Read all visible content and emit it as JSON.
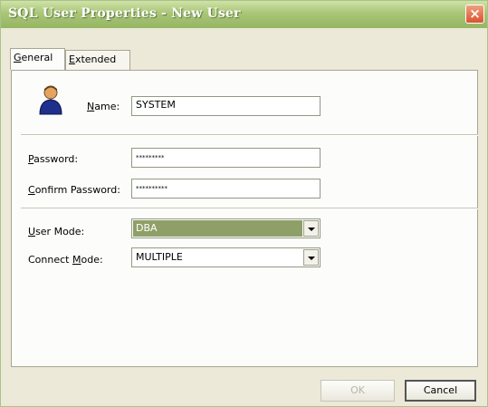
{
  "window": {
    "title": "SQL User Properties - New User",
    "close_glyph": "×"
  },
  "tabs": [
    {
      "label_u": "G",
      "label_rest": "eneral",
      "active": true
    },
    {
      "label_u": "E",
      "label_rest": "xtended",
      "active": false
    }
  ],
  "form": {
    "name": {
      "label_u": "N",
      "label_rest": "ame:",
      "value": "SYSTEM"
    },
    "password": {
      "label_u": "P",
      "label_rest": "assword:",
      "masked": "*********"
    },
    "confirm_password": {
      "label_u": "C",
      "label_rest": "onfirm Password:",
      "masked": "**********"
    },
    "user_mode": {
      "label_u": "U",
      "label_pre": "",
      "label_rest": "ser Mode:",
      "value": "DBA"
    },
    "connect_mode": {
      "label_pre": "Connect ",
      "label_u": "M",
      "label_rest": "ode:",
      "value": "MULTIPLE"
    }
  },
  "buttons": {
    "ok": "OK",
    "cancel": "Cancel"
  },
  "icons": {
    "user": "user-icon"
  },
  "colors": {
    "titlebar": "#a9c677",
    "close": "#d8532d",
    "selection": "#8f9f68"
  }
}
